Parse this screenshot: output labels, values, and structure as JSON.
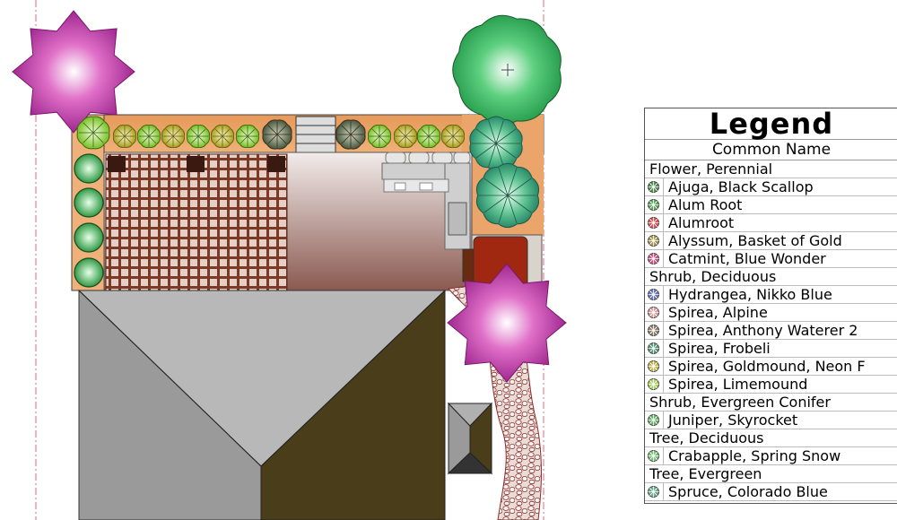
{
  "legend": {
    "title": "Legend",
    "column_header": "Common Name",
    "groups": [
      {
        "category": "Flower, Perennial",
        "items": [
          {
            "label": "Ajuga, Black Scallop",
            "icon": "ajuga-icon",
            "color": "#1f6b1f"
          },
          {
            "label": "Alum Root",
            "icon": "alum-root-icon",
            "color": "#2a8a2a"
          },
          {
            "label": "Alumroot",
            "icon": "alumroot-icon",
            "color": "#d42020"
          },
          {
            "label": "Alyssum, Basket of Gold",
            "icon": "alyssum-icon",
            "color": "#8a7a20"
          },
          {
            "label": "Catmint, Blue Wonder",
            "icon": "catmint-icon",
            "color": "#c02060"
          }
        ]
      },
      {
        "category": "Shrub, Deciduous",
        "items": [
          {
            "label": "Hydrangea, Nikko Blue",
            "icon": "hydrangea-icon",
            "color": "#3a4aa0"
          },
          {
            "label": "Spirea, Alpine",
            "icon": "spirea-alpine-icon",
            "color": "#d08080"
          },
          {
            "label": "Spirea, Anthony Waterer 2",
            "icon": "spirea-anthony-icon",
            "color": "#6a5a40"
          },
          {
            "label": "Spirea, Frobeli",
            "icon": "spirea-frobeli-icon",
            "color": "#2a7a5a"
          },
          {
            "label": "Spirea, Goldmound, Neon F",
            "icon": "spirea-goldmound-icon",
            "color": "#b0a020"
          },
          {
            "label": "Spirea, Limemound",
            "icon": "spirea-limemound-icon",
            "color": "#90c030"
          }
        ]
      },
      {
        "category": "Shrub, Evergreen Conifer",
        "items": [
          {
            "label": "Juniper, Skyrocket",
            "icon": "juniper-icon",
            "color": "#3a9a3a"
          }
        ]
      },
      {
        "category": "Tree, Deciduous",
        "items": [
          {
            "label": "Crabapple, Spring Snow",
            "icon": "crabapple-icon",
            "color": "#50b050"
          }
        ]
      },
      {
        "category": "Tree, Evergreen",
        "items": [
          {
            "label": "Spruce, Colorado Blue",
            "icon": "spruce-icon",
            "color": "#409070"
          }
        ]
      }
    ]
  },
  "colors": {
    "mulch": "#e8a25c",
    "pergola": "#7a3a26",
    "roof_light": "#b8b8b8",
    "roof_dark": "#4a3e1a",
    "tree_purple": "#c040a0",
    "tree_green": "#3cb860",
    "property_line": "#e06a7a"
  }
}
